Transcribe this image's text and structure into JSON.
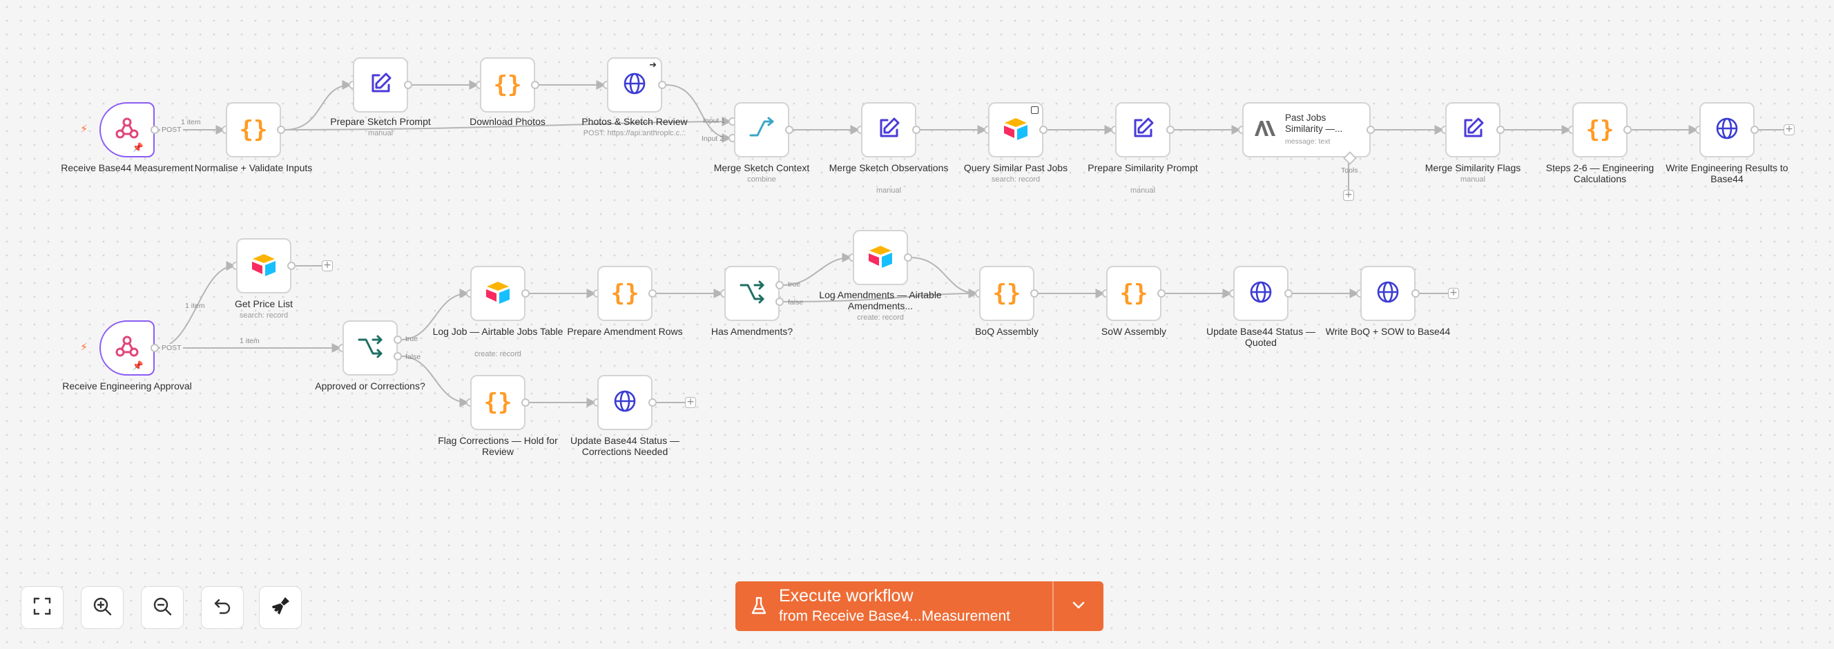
{
  "nodes": {
    "receive_measurement": {
      "label": "Receive Base44 Measurement"
    },
    "normalise": {
      "label": "Normalise + Validate Inputs"
    },
    "prepare_sketch_prompt": {
      "label": "Prepare Sketch Prompt",
      "sub": "manual"
    },
    "download_photos": {
      "label": "Download Photos"
    },
    "photos_sketch_review": {
      "label": "Photos & Sketch Review",
      "sub": "POST: https://api.anthropic.c..."
    },
    "merge_sketch_context": {
      "label": "Merge Sketch Context",
      "sub": "combine"
    },
    "merge_sketch_observations": {
      "label": "Merge Sketch Observations",
      "sub": "manual"
    },
    "query_similar_jobs": {
      "label": "Query Similar Past Jobs",
      "sub": "search: record"
    },
    "prepare_similarity_prompt": {
      "label": "Prepare Similarity Prompt",
      "sub": "manual"
    },
    "past_jobs_similarity": {
      "title": "Past Jobs Similarity —...",
      "sub": "message: text",
      "port_label": "Tools"
    },
    "merge_similarity_flags": {
      "label": "Merge Similarity Flags",
      "sub": "manual"
    },
    "steps_calculations": {
      "label": "Steps 2-6 — Engineering Calculations"
    },
    "write_engineering_results": {
      "label": "Write Engineering Results to Base44"
    },
    "receive_approval": {
      "label": "Receive Engineering Approval"
    },
    "get_price_list": {
      "label": "Get Price List",
      "sub": "search: record"
    },
    "approved_or_corrections": {
      "label": "Approved or Corrections?"
    },
    "log_job": {
      "label": "Log Job — Airtable Jobs Table",
      "sub": "create: record"
    },
    "prepare_amendment_rows": {
      "label": "Prepare Amendment Rows"
    },
    "has_amendments": {
      "label": "Has Amendments?"
    },
    "log_amendments": {
      "label": "Log Amendments — Airtable Amendments...",
      "sub": "create: record"
    },
    "boq_assembly": {
      "label": "BoQ Assembly"
    },
    "sow_assembly": {
      "label": "SoW Assembly"
    },
    "update_status_quoted": {
      "label": "Update Base44 Status — Quoted"
    },
    "write_boq_sow": {
      "label": "Write BoQ + SOW to Base44"
    },
    "flag_corrections": {
      "label": "Flag Corrections — Hold for Review"
    },
    "update_status_corrections": {
      "label": "Update Base44 Status — Corrections Needed"
    }
  },
  "edge_labels": {
    "items_1": "1 item",
    "post": "POST",
    "input_1": "Input 1",
    "input_2": "Input 2",
    "true_label": "true",
    "false_label": "false"
  },
  "controls": {
    "fit_view": "fit-view-icon",
    "zoom_in": "zoom-in-icon",
    "zoom_out": "zoom-out-icon",
    "reset_zoom": "reset-zoom-icon",
    "tidy_up": "tidy-up-icon"
  },
  "execute": {
    "title": "Execute workflow",
    "subtitle": "from Receive Base4...Measurement"
  },
  "colors": {
    "accent": "#ee6b35",
    "trigger_border": "#8b5cf6",
    "code_icon": "#ff9b26",
    "http_icon": "#3b3bd4",
    "edit_icon": "#4a3ad8",
    "if_icon": "#1e6f63",
    "merge_icon": "#3aa6c9"
  }
}
